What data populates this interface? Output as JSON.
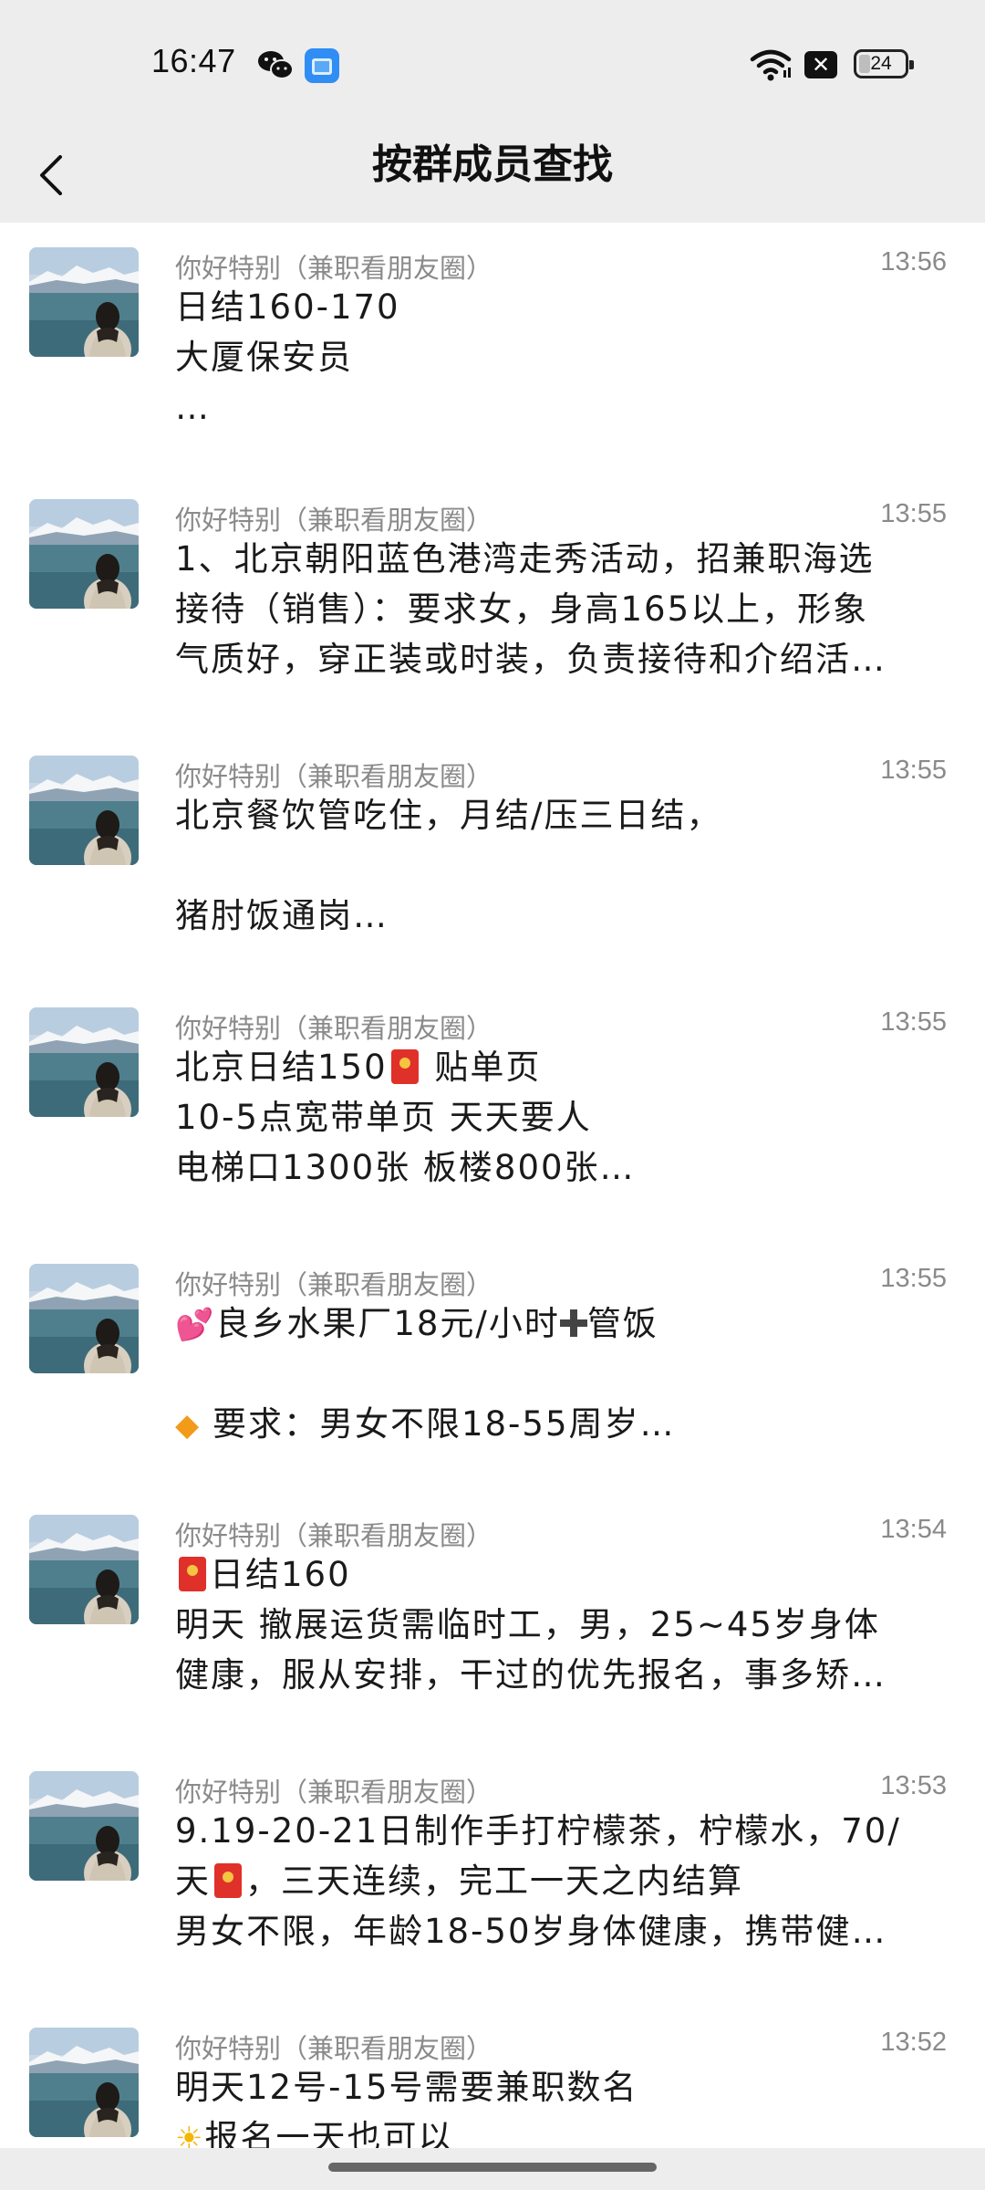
{
  "status_bar": {
    "time": "16:47",
    "battery_level": "24",
    "icons": [
      "wechat-icon",
      "blue-app-icon",
      "wifi-icon",
      "close-box-icon",
      "battery-icon"
    ]
  },
  "header": {
    "title": "按群成员查找",
    "back_icon": "chevron-left-icon"
  },
  "messages": [
    {
      "sender": "你好特别（兼职看朋友圈）",
      "time": "13:56",
      "lines": [
        "日结160-170",
        "大厦保安员",
        "…"
      ]
    },
    {
      "sender": "你好特别（兼职看朋友圈）",
      "time": "13:55",
      "lines": [
        "1、北京朝阳蓝色港湾走秀活动，招兼职海选",
        "接待（销售）：要求女，身高165以上，形象",
        "气质好，穿正装或时装，负责接待和介绍活…"
      ]
    },
    {
      "sender": "你好特别（兼职看朋友圈）",
      "time": "13:55",
      "lines": [
        "北京餐饮管吃住，月结/压三日结，",
        "",
        "猪肘饭通岗…"
      ]
    },
    {
      "sender": "你好特别（兼职看朋友圈）",
      "time": "13:55",
      "lines": [
        "北京日结150",
        "贴单页",
        "10-5点宽带单页 天天要人",
        "电梯口1300张 板楼800张…"
      ]
    },
    {
      "sender": "你好特别（兼职看朋友圈）",
      "time": "13:55",
      "lines": [
        "良乡水果厂18元/小时",
        "管饭",
        "",
        "要求：男女不限18-55周岁…"
      ]
    },
    {
      "sender": "你好特别（兼职看朋友圈）",
      "time": "13:54",
      "lines": [
        "日结160",
        "明天 撤展运货需临时工，男，25~45岁身体",
        "健康，服从安排，干过的优先报名，事多矫…"
      ]
    },
    {
      "sender": "你好特别（兼职看朋友圈）",
      "time": "13:53",
      "lines": [
        "9.19-20-21日制作手打柠檬茶，柠檬水，70/",
        "天",
        "，三天连续，完工一天之内结算",
        "男女不限，年龄18-50岁身体健康，携带健…"
      ]
    },
    {
      "sender": "你好特别（兼职看朋友圈）",
      "time": "13:52",
      "lines": [
        "明天12号-15号需要兼职数名",
        "报名一天也可以"
      ]
    }
  ]
}
